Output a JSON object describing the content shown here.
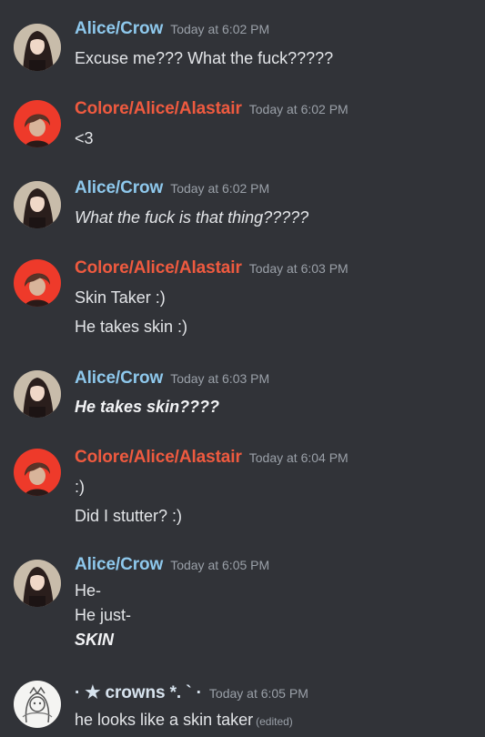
{
  "messages": [
    {
      "author": "Alice/Crow",
      "time": "Today at 6:02 PM",
      "lines": [
        "Excuse me??? What the fuck?????"
      ]
    },
    {
      "author": "Colore/Alice/Alastair",
      "time": "Today at 6:02 PM",
      "lines": [
        "<3"
      ]
    },
    {
      "author": "Alice/Crow",
      "time": "Today at 6:02 PM",
      "lines": [
        "What the fuck is that thing?????"
      ]
    },
    {
      "author": "Colore/Alice/Alastair",
      "time": "Today at 6:03 PM",
      "lines": [
        "Skin Taker :)",
        "He takes skin :)"
      ]
    },
    {
      "author": "Alice/Crow",
      "time": "Today at 6:03 PM",
      "lines": [
        "He takes skin????"
      ]
    },
    {
      "author": "Colore/Alice/Alastair",
      "time": "Today at 6:04 PM",
      "lines": [
        ":)",
        "Did I stutter? :)"
      ]
    },
    {
      "author": "Alice/Crow",
      "time": "Today at 6:05 PM",
      "lines": [
        "He-",
        "He just-",
        "SKIN"
      ]
    },
    {
      "author": "· ★ crowns *. ` ·",
      "time": "Today at 6:05 PM",
      "lines": [
        "he looks like a skin taker"
      ],
      "edited": "(edited)"
    }
  ],
  "colors": {
    "background": "#313338",
    "alice_name": "#8ec8ec",
    "colore_name": "#ef5a3f",
    "crowns_name": "#d7e3ee"
  }
}
